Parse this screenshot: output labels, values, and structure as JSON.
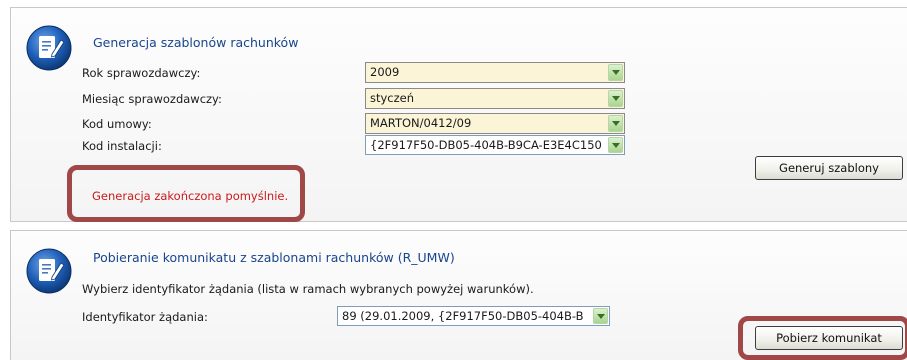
{
  "generation_panel": {
    "title": "Generacja szablonów rachunków",
    "fields": {
      "year": {
        "label": "Rok sprawozdawczy:",
        "value": "2009"
      },
      "month": {
        "label": "Miesiąc sprawozdawczy:",
        "value": "styczeń"
      },
      "contract": {
        "label": "Kod umowy:",
        "value": "MARTON/0412/09"
      },
      "installation": {
        "label": "Kod instalacji:",
        "value": "{2F917F50-DB05-404B-B9CA-E3E4C150"
      }
    },
    "generate_button": "Generuj szablony",
    "status_message": "Generacja zakończona pomyślnie."
  },
  "download_panel": {
    "title": "Pobieranie komunikatu z szablonami rachunków (R_UMW)",
    "instruction": "Wybierz identyfikator żądania (lista w ramach wybranych powyżej warunków).",
    "request_id": {
      "label": "Identyfikator żądania:",
      "value": "89 (29.01.2009, {2F917F50-DB05-404B-B"
    },
    "download_button": "Pobierz komunikat"
  },
  "icons": {
    "panel_badge": "edit-document-icon",
    "dropdown_arrow": "chevron-down-icon"
  },
  "colors": {
    "title": "#17458e",
    "status_success": "#cc1a1a",
    "annotation_frame": "#a04747",
    "select_background": "#fbf4d6"
  }
}
